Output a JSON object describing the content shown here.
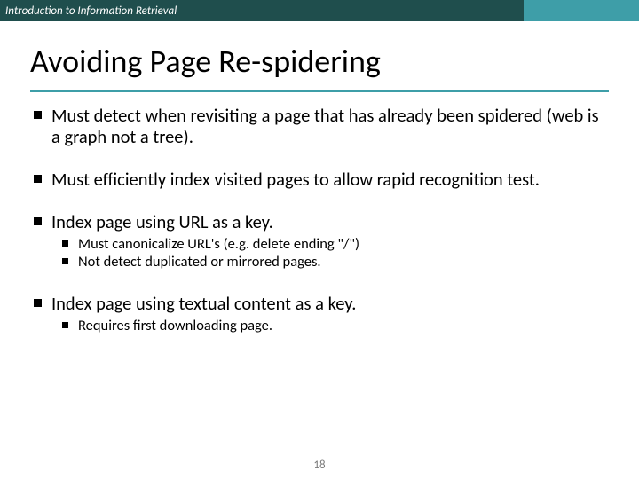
{
  "header": {
    "course": "Introduction to Information Retrieval"
  },
  "title": "Avoiding Page Re-spidering",
  "bullets": [
    {
      "text": "Must detect when revisiting a page that has already been spidered (web is a graph not a tree).",
      "sub": []
    },
    {
      "text": "Must efficiently index visited pages to allow rapid recognition test.",
      "sub": []
    },
    {
      "text": "Index page using URL as a key.",
      "sub": [
        "Must canonicalize URL's (e.g. delete ending \"/\")",
        "Not detect duplicated or mirrored pages."
      ]
    },
    {
      "text": "Index page using textual content as a key.",
      "sub": [
        "Requires first downloading page."
      ]
    }
  ],
  "page_number": "18"
}
